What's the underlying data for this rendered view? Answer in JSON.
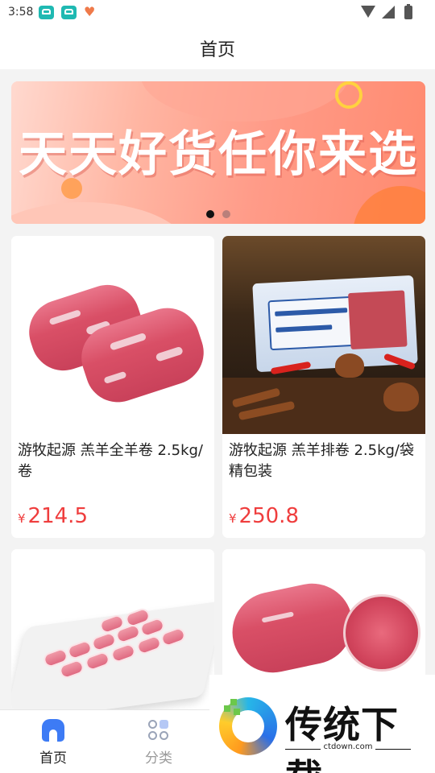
{
  "status_bar": {
    "time": "3:58",
    "icons": [
      "app-notification-icon",
      "app-notification-icon",
      "heart-app-icon",
      "wifi-icon",
      "signal-icon",
      "battery-icon"
    ]
  },
  "header": {
    "title": "首页"
  },
  "banner": {
    "text": "天天好货任你来选",
    "pagination": {
      "count": 2,
      "active_index": 0
    }
  },
  "products": [
    {
      "name": "游牧起源 羔羊全羊卷 2.5kg/卷",
      "currency": "¥",
      "price": "214.5"
    },
    {
      "name": "游牧起源 羔羊排卷 2.5kg/袋 精包装",
      "currency": "¥",
      "price": "250.8"
    },
    {
      "name": "",
      "currency": "",
      "price": ""
    },
    {
      "name": "",
      "currency": "",
      "price": ""
    }
  ],
  "tab_bar": {
    "tabs": [
      {
        "label": "首页",
        "icon": "home-icon",
        "active": true
      },
      {
        "label": "分类",
        "icon": "category-icon",
        "active": false
      }
    ]
  },
  "watermark": {
    "title": "传统下载",
    "url": "ctdown.com"
  },
  "colors": {
    "price": "#ef3d3d",
    "accent": "#3d7bf5",
    "banner": "#ff9b88"
  }
}
